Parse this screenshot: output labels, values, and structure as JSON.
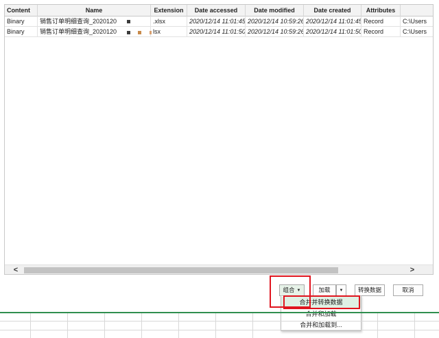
{
  "table": {
    "columns": [
      "Content",
      "Name",
      "Extension",
      "Date accessed",
      "Date modified",
      "Date created",
      "Attributes",
      ""
    ],
    "rows": [
      {
        "content": "Binary",
        "name": "销售订单明细查询_2020120",
        "extension": ".xlsx",
        "date_accessed": "2020/12/14 11:01:45",
        "date_modified": "2020/12/14 10:59:26",
        "date_created": "2020/12/14 11:01:45",
        "attributes": "Record",
        "path": "C:\\Users"
      },
      {
        "content": "Binary",
        "name": "销售订单明细查询_2020120",
        "extension": "lsx",
        "date_accessed": "2020/12/14 11:01:50",
        "date_modified": "2020/12/14 10:59:26",
        "date_created": "2020/12/14 11:01:50",
        "attributes": "Record",
        "path": "C:\\Users"
      }
    ]
  },
  "scrollbar": {
    "left_arrow": "<",
    "right_arrow": ">"
  },
  "buttons": {
    "combine": "组合",
    "load": "加载",
    "transform": "转换数据",
    "cancel": "取消"
  },
  "combine_menu": {
    "items": [
      "合并并转换数据",
      "合并和加载",
      "合并和加载到..."
    ],
    "selected_index": 0
  },
  "colors": {
    "highlight": "#e0141e",
    "accent": "#2f8f4f"
  }
}
